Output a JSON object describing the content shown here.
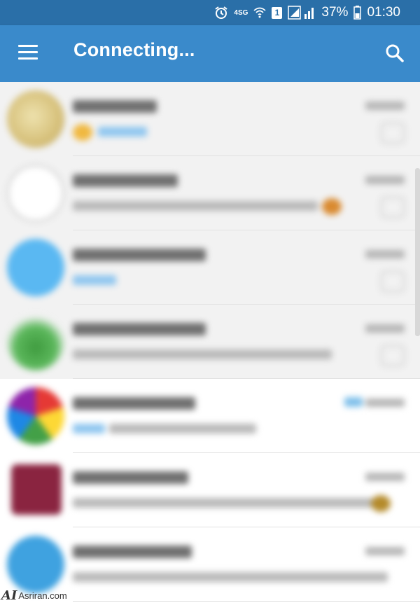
{
  "status_bar": {
    "network_label": "4SG",
    "sim_label": "1",
    "battery_percent": "37%",
    "time": "01:30",
    "icons": [
      "alarm-icon",
      "wifi-icon",
      "sim-icon",
      "signal-icon",
      "battery-icon"
    ]
  },
  "app_bar": {
    "title": "Connecting...",
    "menu_icon": "hamburger-menu-icon",
    "search_icon": "search-icon",
    "color": "#3a8acb",
    "status_color": "#2a6fa8"
  },
  "chats": [
    {
      "avatar_color": "#d8c68a",
      "shaded": true,
      "preview_style": "blue-emoji"
    },
    {
      "avatar_color": "#e9e9e9",
      "shaded": true,
      "preview_style": "gray-emoji"
    },
    {
      "avatar_color": "#5ab8f2",
      "shaded": true,
      "preview_style": "blue"
    },
    {
      "avatar_color": "#4aa84a",
      "shaded": true,
      "preview_style": "gray"
    },
    {
      "avatar_color": "#e25a4a",
      "shaded": false,
      "preview_style": "blue",
      "read_check": true
    },
    {
      "avatar_color": "#8a2440",
      "shaded": false,
      "preview_style": "gray-emoji"
    },
    {
      "avatar_color": "#3fa2e0",
      "shaded": false,
      "preview_style": "gray"
    }
  ],
  "watermark": {
    "logo": "AI",
    "site": "Asriran.com"
  }
}
